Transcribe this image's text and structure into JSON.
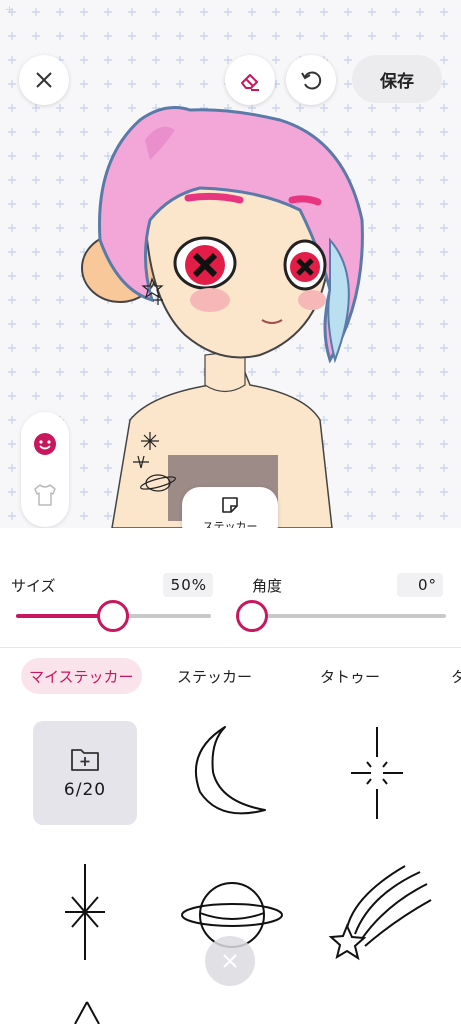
{
  "toolbar": {
    "close_icon": "close-icon",
    "eraser_icon": "eraser-icon",
    "undo_icon": "undo-icon",
    "save_label": "保存"
  },
  "side_panel": {
    "items": [
      {
        "icon": "face-icon",
        "selected": true
      },
      {
        "icon": "shirt-icon",
        "selected": false
      }
    ]
  },
  "sticker_tab": {
    "label": "ステッカー",
    "icon": "sticker-icon"
  },
  "size": {
    "label": "サイズ",
    "value_text": "50%",
    "value": 0.5
  },
  "angle": {
    "label": "角度",
    "value_text": "0°",
    "value": 0
  },
  "tabs": [
    {
      "label": "マイステッカー",
      "active": true
    },
    {
      "label": "ステッカー",
      "active": false
    },
    {
      "label": "タトゥー",
      "active": false
    },
    {
      "label": "タ",
      "active": false
    }
  ],
  "my_stickers": {
    "count_text": "6/20",
    "folder_icon": "folder-add-icon"
  },
  "stickers": [
    "crescent-moon-icon",
    "sparkle-icon",
    "star-burst-icon",
    "planet-icon",
    "shooting-star-icon",
    "triangle-icon"
  ],
  "colors": {
    "accent": "#c8175d",
    "accent_light": "#fbe3ec",
    "hair": "#f3a6d8"
  }
}
